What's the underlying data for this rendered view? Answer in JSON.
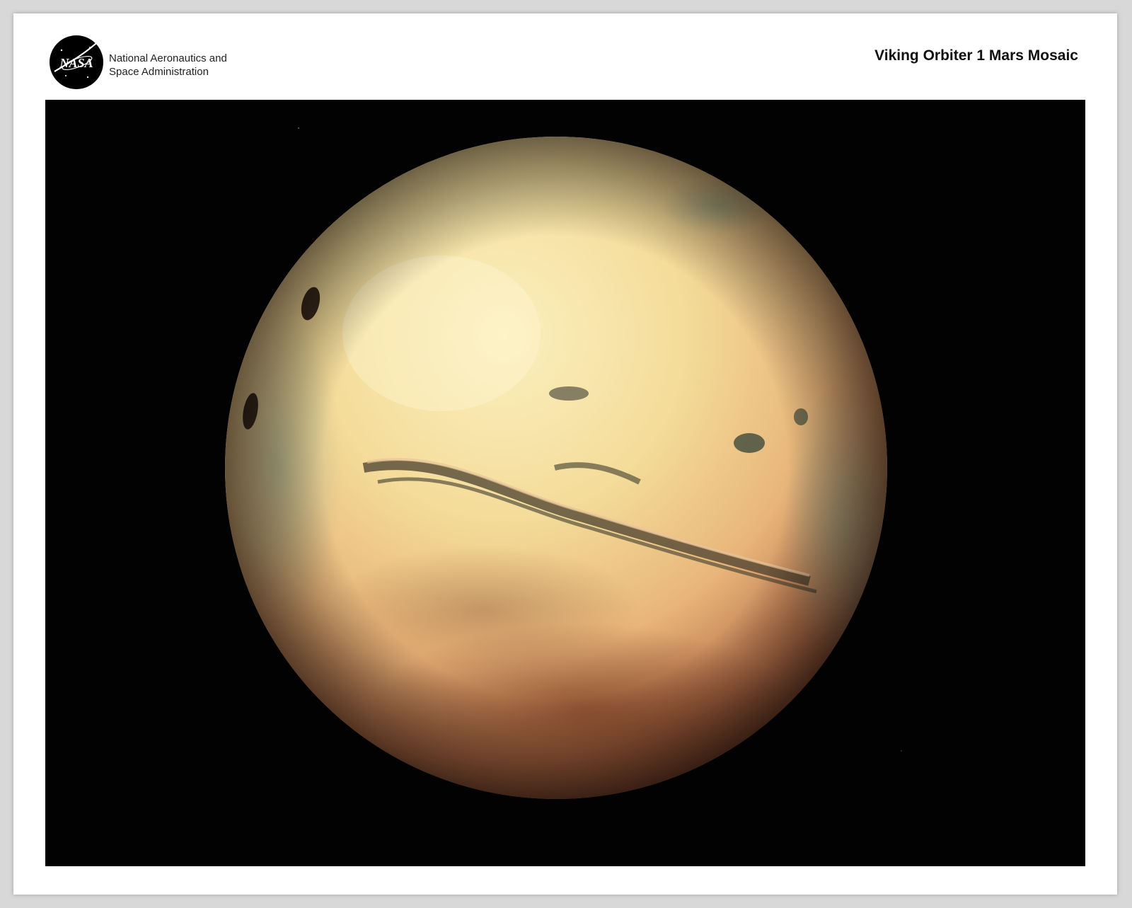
{
  "header": {
    "agency_line1": "National Aeronautics and",
    "agency_line2": "Space Administration",
    "title": "Viking Orbiter 1 Mars Mosaic"
  },
  "logo": {
    "icon": "nasa-meatball-icon",
    "text": "NASA"
  },
  "photo": {
    "subject": "mars-globe",
    "colors": {
      "space": "#020202",
      "planet_light": "#f7e6a8",
      "planet_mid": "#e8b57a",
      "planet_dark": "#5a2a16",
      "canyon": "#3c3a2c"
    }
  }
}
